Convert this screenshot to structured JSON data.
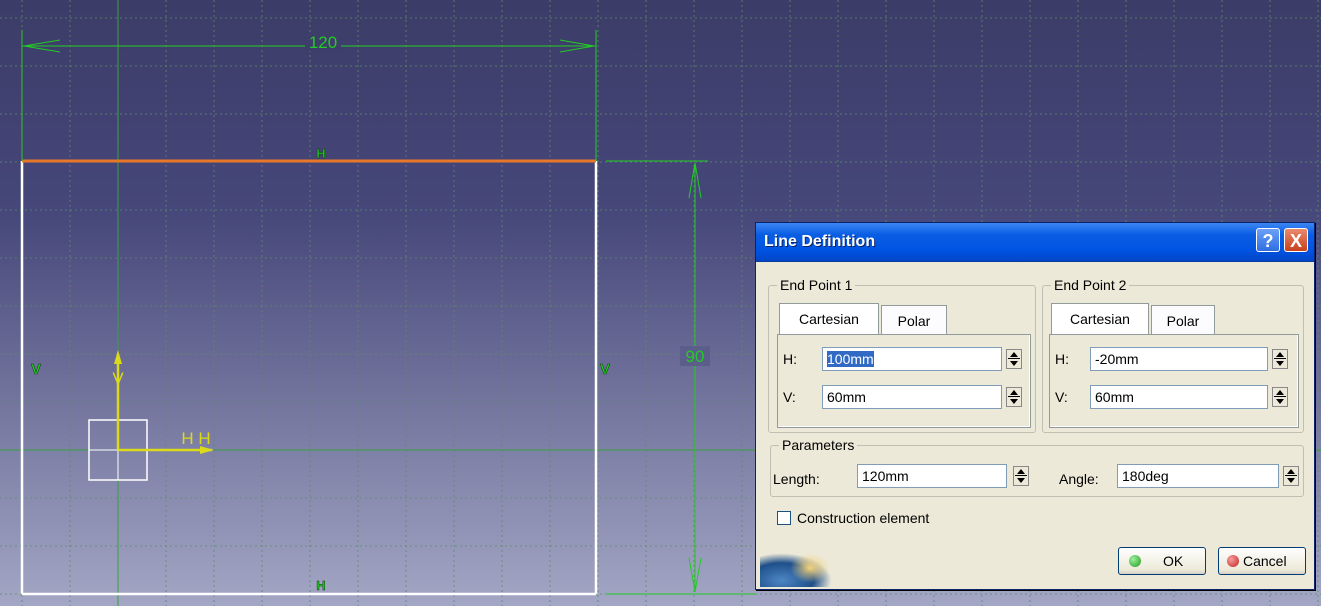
{
  "sketch": {
    "width_dimension": "120",
    "height_dimension": "90",
    "top_constraint": "H",
    "bottom_constraint": "H",
    "left_constraint": "V",
    "right_constraint": "V",
    "axis_h_labels": "H H",
    "axis_v_label": "V",
    "colors": {
      "background_top": "#3e3f6a",
      "background_bottom": "#a3a6c4",
      "dimension": "#22cc22",
      "selected_line": "#e8772a",
      "axis": "#dada1a"
    }
  },
  "dialog": {
    "title": "Line Definition",
    "help_icon": "?",
    "close_icon": "X",
    "end_point_1": {
      "label": "End Point 1",
      "tabs": [
        "Cartesian",
        "Polar"
      ],
      "h_label": "H:",
      "h_value": "100mm",
      "v_label": "V:",
      "v_value": "60mm"
    },
    "end_point_2": {
      "label": "End Point 2",
      "tabs": [
        "Cartesian",
        "Polar"
      ],
      "h_label": "H:",
      "h_value": "-20mm",
      "v_label": "V:",
      "v_value": "60mm"
    },
    "parameters": {
      "label": "Parameters",
      "length_label": "Length:",
      "length_value": "120mm",
      "angle_label": "Angle:",
      "angle_value": "180deg"
    },
    "construction_label": "Construction element",
    "ok_label": "OK",
    "cancel_label": "Cancel"
  }
}
